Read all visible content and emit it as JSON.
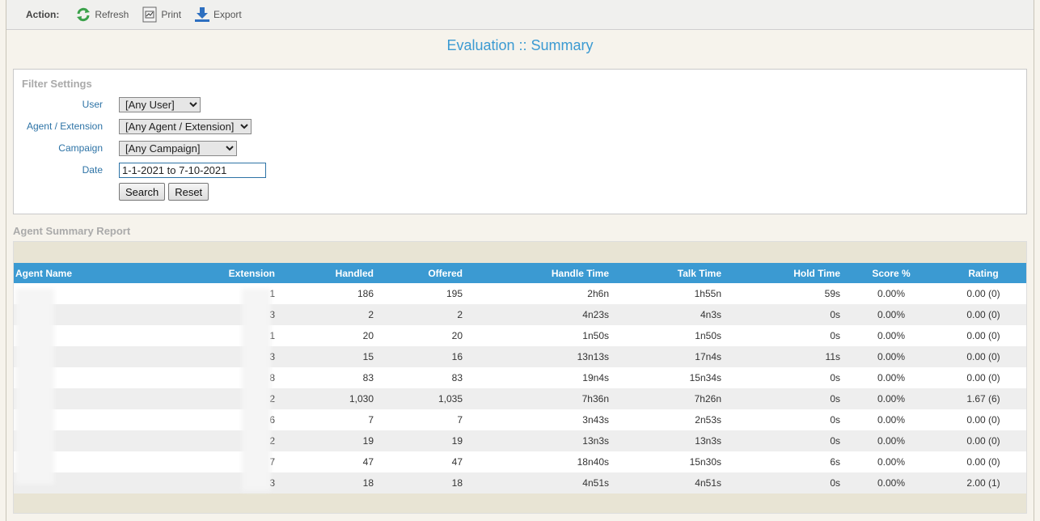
{
  "toolbar": {
    "action_label": "Action:",
    "refresh_label": "Refresh",
    "print_label": "Print",
    "export_label": "Export",
    "colors": {
      "refresh": "#3aa14a",
      "export": "#2d6fc0"
    }
  },
  "page": {
    "title": "Evaluation :: Summary"
  },
  "filters": {
    "legend": "Filter Settings",
    "user": {
      "label": "User",
      "value": "[Any User]"
    },
    "agent": {
      "label": "Agent / Extension",
      "value": "[Any Agent / Extension]"
    },
    "campaign": {
      "label": "Campaign",
      "value": "[Any Campaign]"
    },
    "date": {
      "label": "Date",
      "value": "1-1-2021 to 7-10-2021"
    },
    "search_label": "Search",
    "reset_label": "Reset"
  },
  "report": {
    "title": "Agent Summary Report",
    "columns": {
      "agent_name": "Agent Name",
      "extension": "Extension",
      "handled": "Handled",
      "offered": "Offered",
      "handle_time": "Handle Time",
      "talk_time": "Talk Time",
      "hold_time": "Hold Time",
      "score": "Score %",
      "rating": "Rating"
    },
    "rows": [
      {
        "name": "",
        "ext": "1",
        "handled": "186",
        "offered": "195",
        "ht": "2h6n",
        "tt": "1h55n",
        "hold": "59s",
        "score": "0.00%",
        "rating": "0.00 (0)"
      },
      {
        "name": "",
        "ext": "3",
        "handled": "2",
        "offered": "2",
        "ht": "4n23s",
        "tt": "4n3s",
        "hold": "0s",
        "score": "0.00%",
        "rating": "0.00 (0)"
      },
      {
        "name": "",
        "ext": "1",
        "handled": "20",
        "offered": "20",
        "ht": "1n50s",
        "tt": "1n50s",
        "hold": "0s",
        "score": "0.00%",
        "rating": "0.00 (0)"
      },
      {
        "name": "",
        "ext": "3",
        "handled": "15",
        "offered": "16",
        "ht": "13n13s",
        "tt": "17n4s",
        "hold": "11s",
        "score": "0.00%",
        "rating": "0.00 (0)"
      },
      {
        "name": "",
        "ext": "8",
        "handled": "83",
        "offered": "83",
        "ht": "19n4s",
        "tt": "15n34s",
        "hold": "0s",
        "score": "0.00%",
        "rating": "0.00 (0)"
      },
      {
        "name": "",
        "ext": "2",
        "handled": "1,030",
        "offered": "1,035",
        "ht": "7h36n",
        "tt": "7h26n",
        "hold": "0s",
        "score": "0.00%",
        "rating": "1.67 (6)"
      },
      {
        "name": "",
        "ext": "6",
        "handled": "7",
        "offered": "7",
        "ht": "3n43s",
        "tt": "2n53s",
        "hold": "0s",
        "score": "0.00%",
        "rating": "0.00 (0)"
      },
      {
        "name": "",
        "ext": "2",
        "handled": "19",
        "offered": "19",
        "ht": "13n3s",
        "tt": "13n3s",
        "hold": "0s",
        "score": "0.00%",
        "rating": "0.00 (0)"
      },
      {
        "name": "",
        "ext": "7",
        "handled": "47",
        "offered": "47",
        "ht": "18n40s",
        "tt": "15n30s",
        "hold": "6s",
        "score": "0.00%",
        "rating": "0.00 (0)"
      },
      {
        "name": "",
        "ext": "3",
        "handled": "18",
        "offered": "18",
        "ht": "4n51s",
        "tt": "4n51s",
        "hold": "0s",
        "score": "0.00%",
        "rating": "2.00 (1)"
      }
    ]
  }
}
